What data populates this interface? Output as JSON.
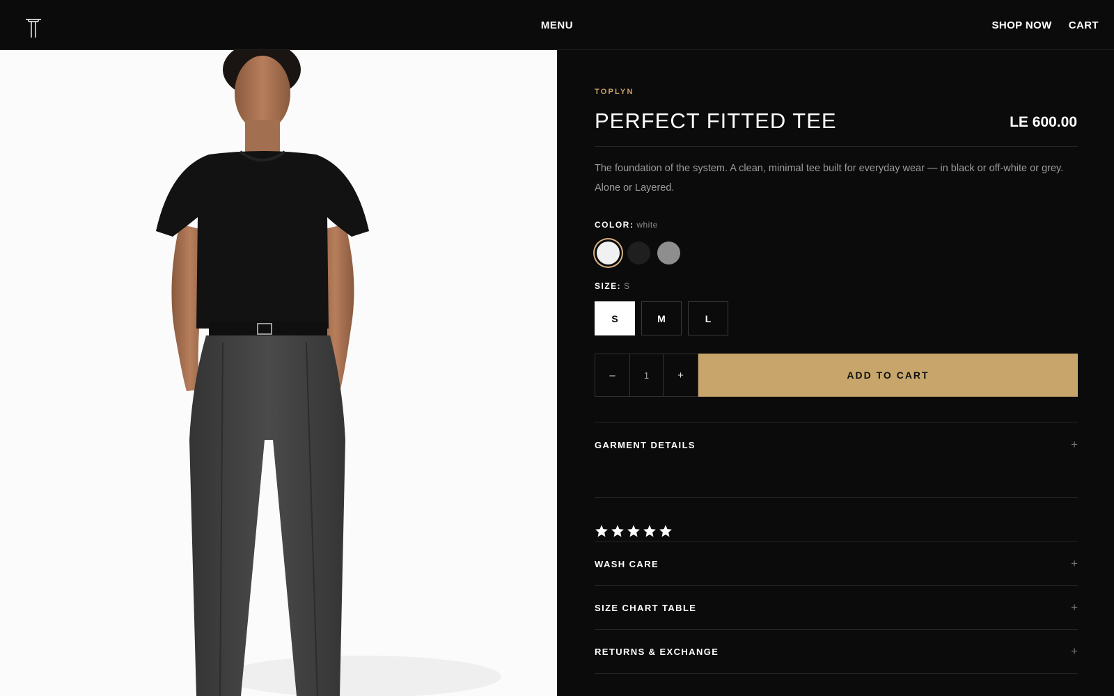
{
  "header": {
    "menu_label": "MENU",
    "shop_label": "SHOP NOW",
    "cart_label": "CART"
  },
  "product": {
    "brand": "TOPLYN",
    "title": "PERFECT FITTED TEE",
    "price": "LE 600.00",
    "description": "The foundation of the system. A clean, minimal tee built for everyday wear — in black or off-white or grey. Alone or Layered.",
    "color_label": "COLOR:",
    "color_selected": "white",
    "colors": [
      {
        "name": "white",
        "hex": "#f1f1f1"
      },
      {
        "name": "black",
        "hex": "#1f1f1f"
      },
      {
        "name": "grey",
        "hex": "#8e8e8e"
      }
    ],
    "size_label": "SIZE:",
    "size_selected": "S",
    "sizes": [
      "S",
      "M",
      "L"
    ],
    "quantity": "1",
    "minus": "–",
    "plus": "+",
    "add_to_cart": "ADD TO CART",
    "rating_stars": 5
  },
  "accordions": {
    "garment_details": "GARMENT DETAILS",
    "wash_care": "WASH CARE",
    "size_chart": "SIZE CHART TABLE",
    "returns": "RETURNS & EXCHANGE",
    "plus_glyph": "+"
  },
  "colors": {
    "background": "#0b0b0c",
    "accent_gold": "#c8a66b",
    "brand_text": "#c9a064"
  }
}
